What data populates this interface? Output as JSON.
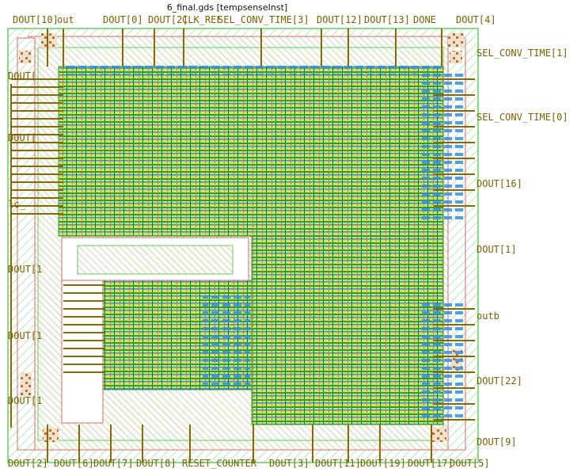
{
  "window": {
    "title": "6_final.gds [tempsenseInst]"
  },
  "pins": {
    "top": [
      "DOUT[10]",
      "out",
      "DOUT[0]",
      "DOUT[2]",
      "CLK_REF",
      "SEL_CONV_TIME[3]",
      "DOUT[12]",
      "DOUT[13]",
      "DONE",
      "DOUT[4]"
    ],
    "right": [
      "SEL_CONV_TIME[1]",
      "SEL_CONV_TIME[0]",
      "DOUT[16]",
      "DOUT[1]",
      "outb",
      "DOUT[22]",
      "DOUT[9]"
    ],
    "left": [
      "DOUT[",
      "DOUT[",
      "lc_",
      "DOUT[1",
      "DOUT[1",
      "DOUT[1"
    ],
    "bottom": [
      "DOUT[2]",
      "DOUT[6]",
      "DOUT[7]",
      "DOUT[8]",
      "RESET_COUNTER",
      "DOUT[3]",
      "DOUT[11]",
      "DOUT[19]",
      "DOUT[17]",
      "DOUT[5]"
    ]
  },
  "colors": {
    "background": "#ffffff",
    "outline": "#5fd35f",
    "hatch": "#bfe8bf",
    "pin_label": "#7a6000",
    "metal_blue": "#2f8fe8",
    "metal_yellow": "#e2e23a",
    "metal_green": "#2f9e2f",
    "poly_red": "#d96b6b",
    "pin_stub": "#8a6a00"
  }
}
